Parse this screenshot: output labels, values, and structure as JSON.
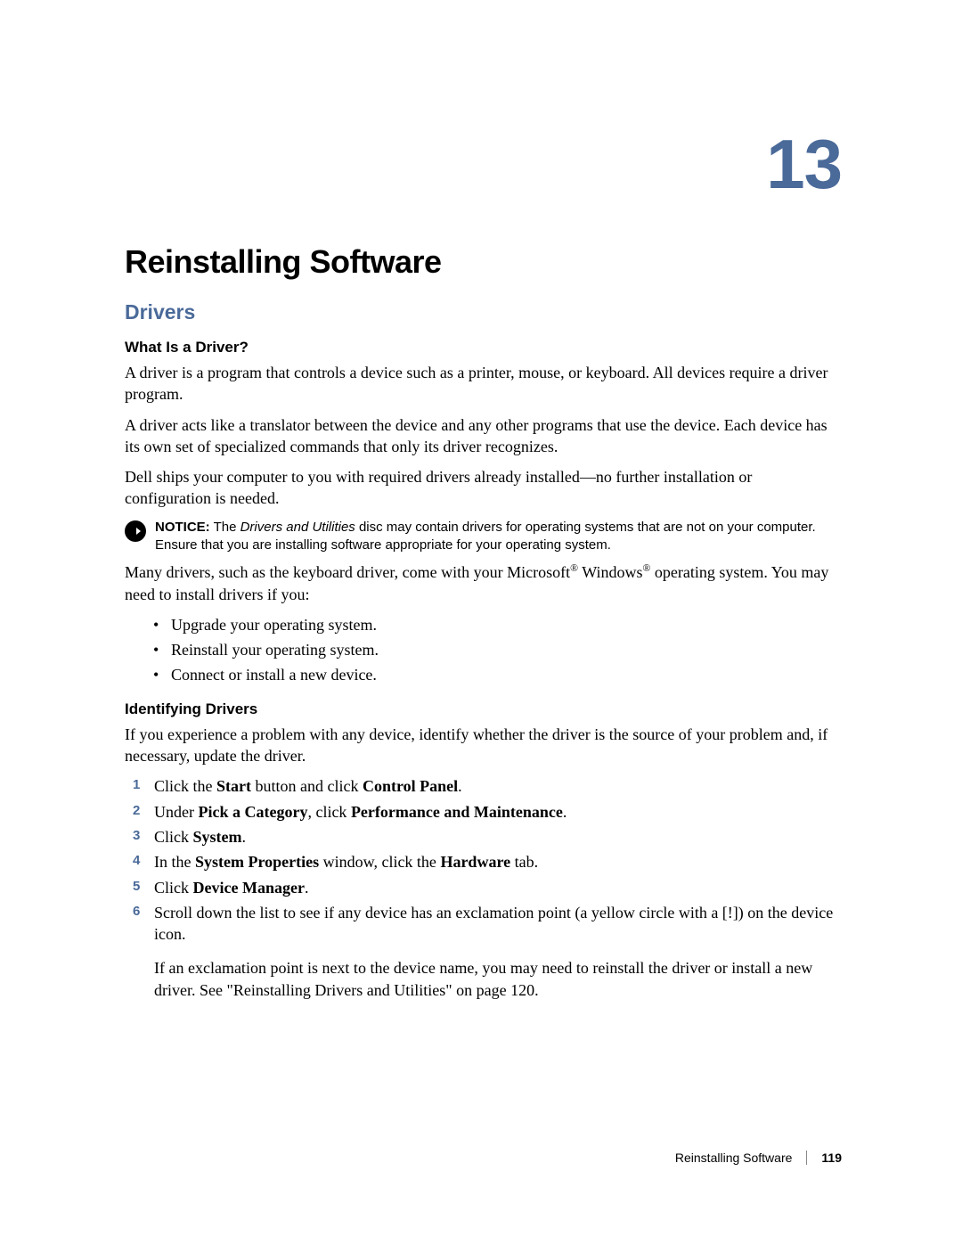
{
  "chapter_number": "13",
  "title": "Reinstalling Software",
  "section1": {
    "heading": "Drivers",
    "sub_what_is": {
      "heading": "What Is a Driver?",
      "p1": "A driver is a program that controls a device such as a printer, mouse, or keyboard. All devices require a driver program.",
      "p2": "A driver acts like a translator between the device and any other programs that use the device. Each device has its own set of specialized commands that only its driver recognizes.",
      "p3": "Dell ships your computer to you with required drivers already installed—no further installation or configuration is needed.",
      "notice_label": "NOTICE:",
      "notice_pre": " The ",
      "notice_em": "Drivers and Utilities",
      "notice_post": " disc may contain drivers for operating systems that are not on your computer. Ensure that you are installing software appropriate for your operating system.",
      "p4_pre": "Many drivers, such as the keyboard driver, come with your Microsoft",
      "p4_mid": " Windows",
      "p4_post": " operating system. You may need to install drivers if you:",
      "bullets": [
        "Upgrade your operating system.",
        "Reinstall your operating system.",
        "Connect or install a new device."
      ]
    },
    "sub_identifying": {
      "heading": "Identifying Drivers",
      "intro": "If you experience a problem with any device, identify whether the driver is the source of your problem and, if necessary, update the driver.",
      "steps": {
        "s1": {
          "pre": "Click the ",
          "b1": "Start",
          "mid": " button and click ",
          "b2": "Control Panel",
          "post": "."
        },
        "s2": {
          "pre": "Under ",
          "b1": "Pick a Category",
          "mid": ", click ",
          "b2": "Performance and Maintenance",
          "post": "."
        },
        "s3": {
          "pre": "Click ",
          "b1": "System",
          "post": "."
        },
        "s4": {
          "pre": "In the ",
          "b1": "System Properties",
          "mid": " window, click the ",
          "b2": "Hardware",
          "post": " tab."
        },
        "s5": {
          "pre": "Click ",
          "b1": "Device Manager",
          "post": "."
        },
        "s6": {
          "p1": "Scroll down the list to see if any device has an exclamation point (a yellow circle with a [!]) on the device icon.",
          "p2": "If an exclamation point is next to the device name, you may need to reinstall the driver or install a new driver. See \"Reinstalling Drivers and Utilities\" on page 120."
        }
      }
    }
  },
  "footer": {
    "label": "Reinstalling Software",
    "page": "119"
  }
}
